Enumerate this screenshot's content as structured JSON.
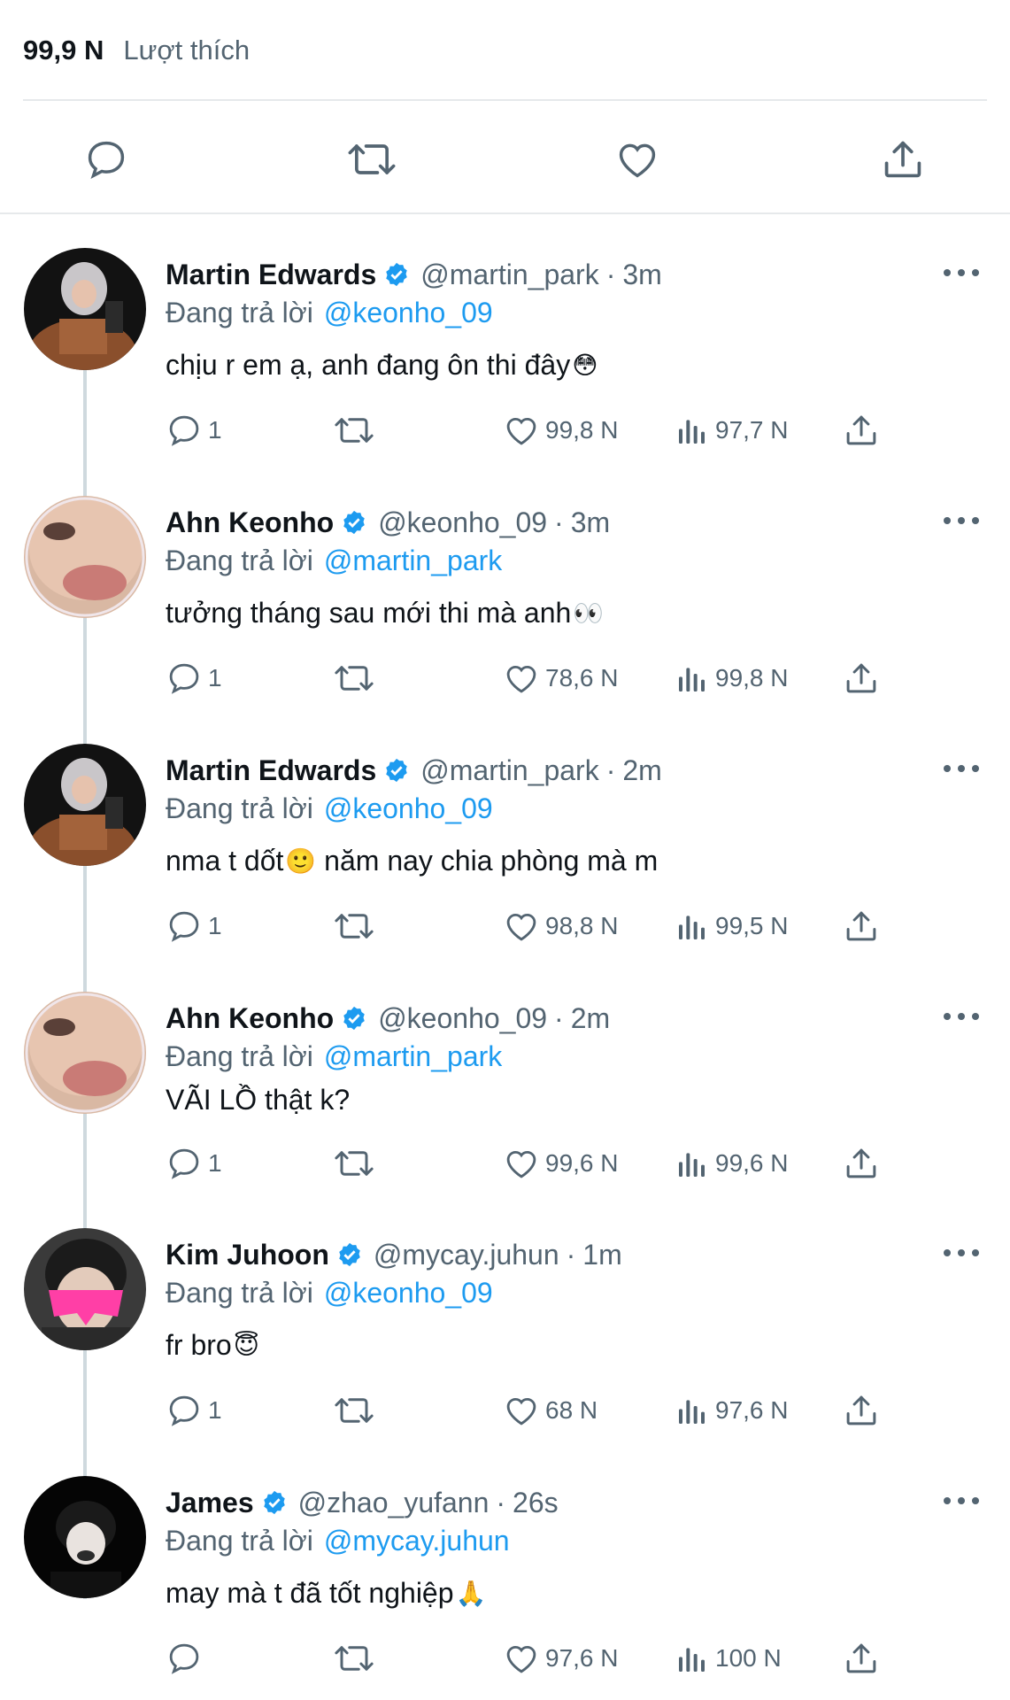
{
  "summary": {
    "likes_count": "99,9 N",
    "likes_label": "Lượt thích"
  },
  "top_actions": [
    "reply-icon",
    "retweet-icon",
    "like-icon",
    "share-icon"
  ],
  "colors": {
    "accent": "#1d9bf0",
    "muted": "#536471",
    "text": "#0f1419",
    "divider": "#e6e9eb"
  },
  "replies": [
    {
      "name": "Martin Edwards",
      "handle": "@martin_park",
      "time": "3m",
      "reply_prefix": "Đang trả lời",
      "reply_to": "@keonho_09",
      "text": "chịu r em ạ, anh đang ôn thi đây",
      "emoji": "😳",
      "reply_count": "1",
      "likes": "99,8 N",
      "views": "97,7 N"
    },
    {
      "name": "Ahn Keonho",
      "handle": "@keonho_09",
      "time": "3m",
      "reply_prefix": "Đang trả lời",
      "reply_to": "@martin_park",
      "text": "tưởng tháng sau mới thi mà anh",
      "emoji": "👀",
      "reply_count": "1",
      "likes": "78,6 N",
      "views": "99,8 N"
    },
    {
      "name": "Martin Edwards",
      "handle": "@martin_park",
      "time": "2m",
      "reply_prefix": "Đang trả lời",
      "reply_to": "@keonho_09",
      "text": "nma t dốt",
      "emoji": "🙂",
      "text_after": " năm nay chia phòng mà m",
      "reply_count": "1",
      "likes": "98,8 N",
      "views": "99,5 N"
    },
    {
      "name": "Ahn Keonho",
      "handle": "@keonho_09",
      "time": "2m",
      "reply_prefix": "Đang trả lời",
      "reply_to": "@martin_park",
      "text": "VÃI LỒ thật k?",
      "emoji": "",
      "reply_count": "1",
      "likes": "99,6 N",
      "views": "99,6 N"
    },
    {
      "name": "Kim Juhoon",
      "handle": "@mycay.juhun",
      "time": "1m",
      "reply_prefix": "Đang trả lời",
      "reply_to": "@keonho_09",
      "text": "fr bro",
      "emoji": "😇",
      "reply_count": "1",
      "likes": "68 N",
      "views": "97,6 N"
    },
    {
      "name": "James",
      "handle": "@zhao_yufann",
      "time": "26s",
      "reply_prefix": "Đang trả lời",
      "reply_to": "@mycay.juhun",
      "text": "may mà t đã tốt nghiệp",
      "emoji": "🙏",
      "reply_count": "",
      "likes": "97,6 N",
      "views": "100 N"
    }
  ]
}
